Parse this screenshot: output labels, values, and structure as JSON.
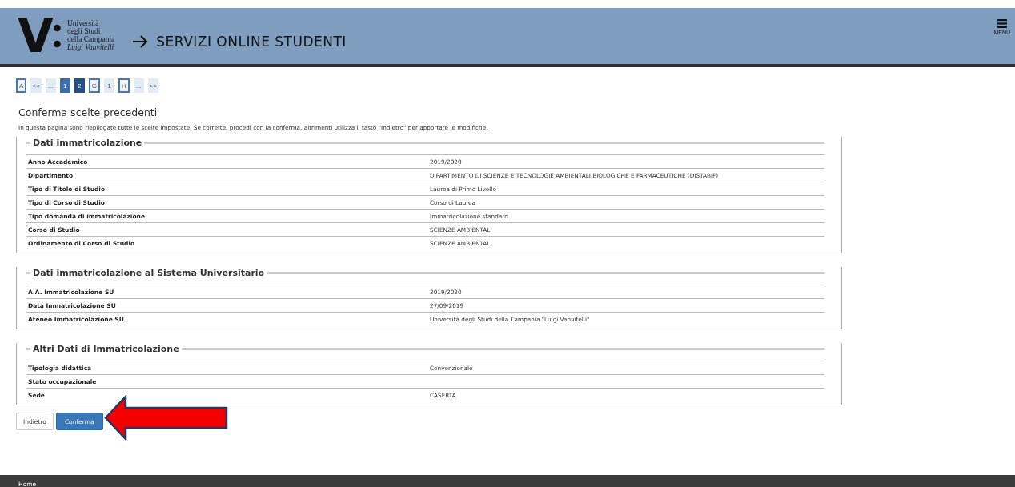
{
  "header": {
    "logo_mark": "V",
    "logo_lines": [
      "Università",
      "degli Studi",
      "della Campania",
      "Luigi Vanvitelli"
    ],
    "title": "SERVIZI ONLINE STUDENTI",
    "menu_label": "MENU"
  },
  "pager": [
    {
      "label": "A",
      "kind": "outlined",
      "selected": false
    },
    {
      "label": "<<",
      "kind": "plain",
      "selected": false
    },
    {
      "label": "...",
      "kind": "plain",
      "selected": false
    },
    {
      "label": "1",
      "kind": "filled",
      "selected": false
    },
    {
      "label": "2",
      "kind": "filled",
      "selected": true
    },
    {
      "label": "G",
      "kind": "outlined",
      "selected": false
    },
    {
      "label": "1",
      "kind": "plain",
      "selected": false
    },
    {
      "label": "H",
      "kind": "outlined",
      "selected": false
    },
    {
      "label": "...",
      "kind": "plain",
      "selected": false
    },
    {
      "label": ">>",
      "kind": "plain",
      "selected": false
    }
  ],
  "page_title": "Conferma scelte precedenti",
  "intro": "In questa pagina sono riepilogate tutte le scelte impostate. Se corrette, procedi con la conferma, altrimenti utilizza il tasto \"Indietro\" per apportare le modifiche.",
  "sections": [
    {
      "legend": "Dati immatricolazione",
      "rows": [
        {
          "label": "Anno Accademico",
          "value": "2019/2020"
        },
        {
          "label": "Dipartimento",
          "value": "DIPARTIMENTO DI SCIENZE E TECNOLOGIE AMBIENTALI BIOLOGICHE E FARMACEUTICHE (DISTABIF)"
        },
        {
          "label": "Tipo di Titolo di Studio",
          "value": "Laurea di Primo Livello"
        },
        {
          "label": "Tipo di Corso di Studio",
          "value": "Corso di Laurea"
        },
        {
          "label": "Tipo domanda di immatricolazione",
          "value": "Immatricolazione standard"
        },
        {
          "label": "Corso di Studio",
          "value": "SCIENZE AMBIENTALI"
        },
        {
          "label": "Ordinamento di Corso di Studio",
          "value": "SCIENZE AMBIENTALI"
        }
      ]
    },
    {
      "legend": "Dati immatricolazione al Sistema Universitario",
      "rows": [
        {
          "label": "A.A. Immatricolazione SU",
          "value": "2019/2020"
        },
        {
          "label": "Data Immatricolazione SU",
          "value": "27/09/2019"
        },
        {
          "label": "Ateneo Immatricolazione SU",
          "value": "Università degli Studi della Campania \"Luigi Vanvitelli\""
        }
      ]
    },
    {
      "legend": "Altri Dati di Immatricolazione",
      "rows": [
        {
          "label": "Tipologia didattica",
          "value": "Convenzionale"
        },
        {
          "label": "Stato occupazionale"
        },
        {
          "label": "Sede",
          "value": "CASERTA"
        }
      ]
    }
  ],
  "buttons": [
    {
      "label": "Indietro",
      "kind": "secondary"
    },
    {
      "label": "Conferma",
      "kind": "primary"
    }
  ],
  "footer": {
    "link": "Home"
  }
}
